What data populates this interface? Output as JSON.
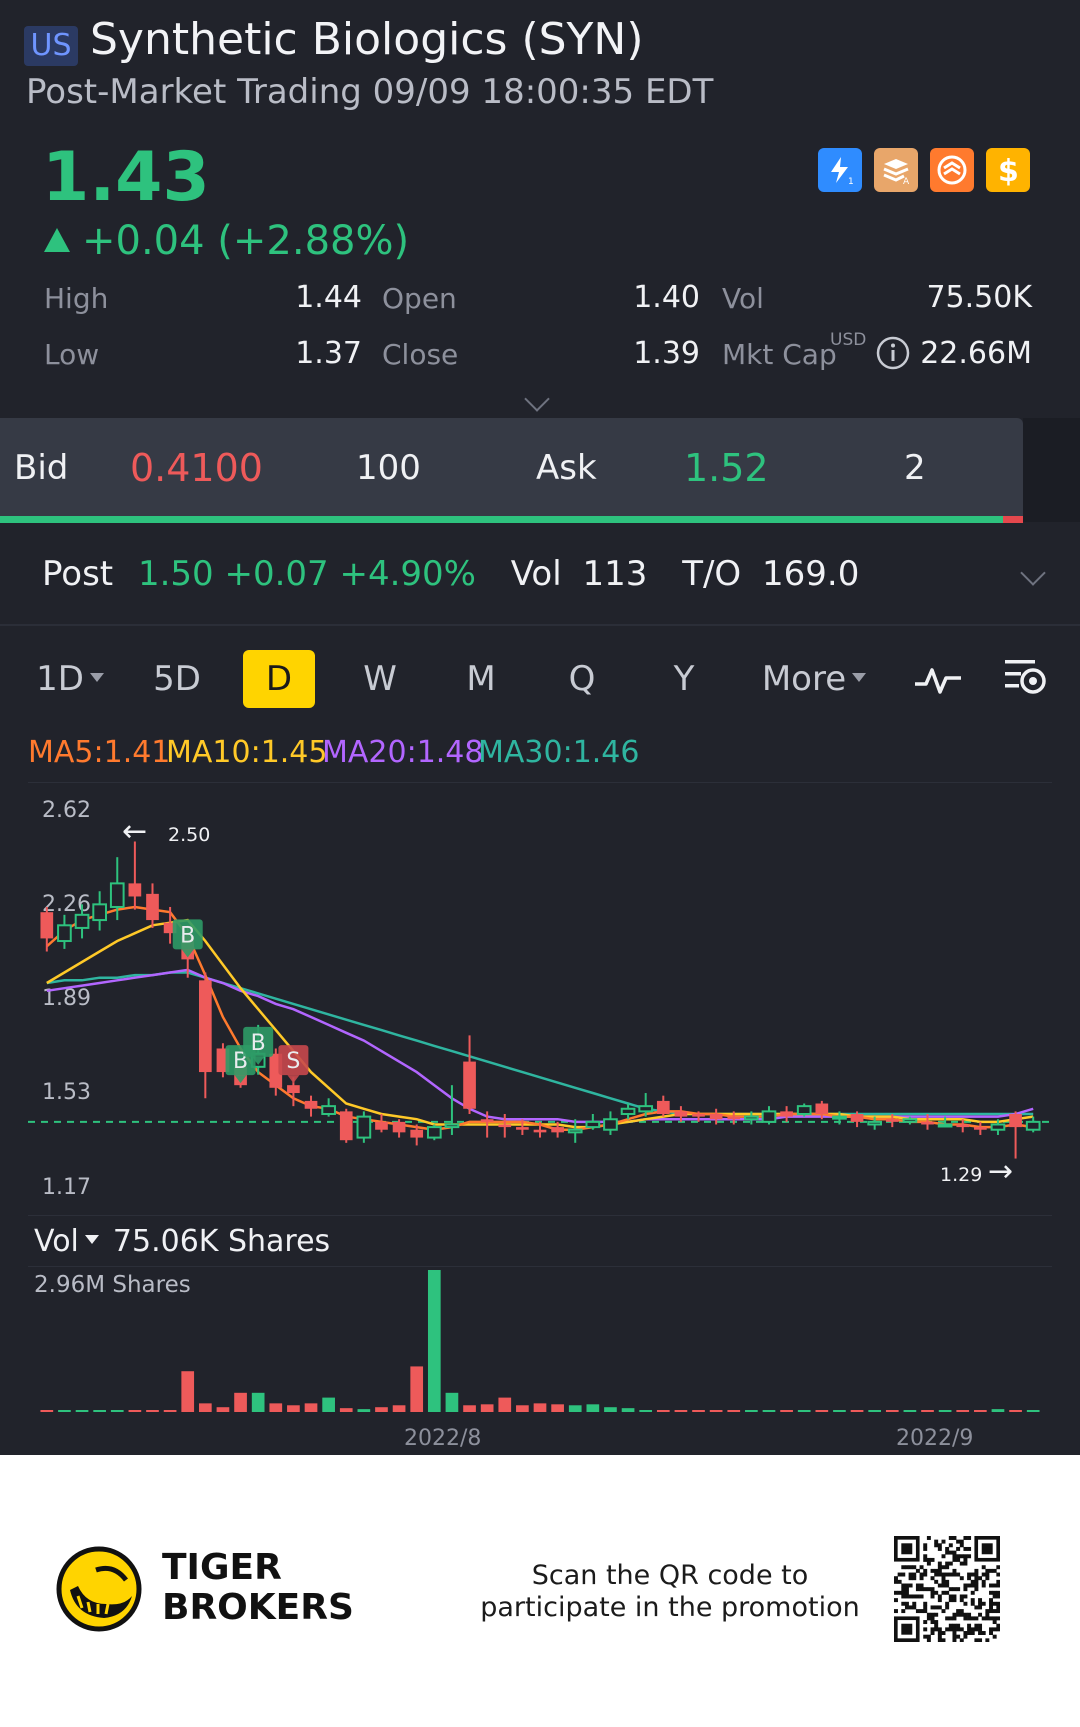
{
  "header": {
    "market_badge": "US",
    "title": "Synthetic Biologics (SYN)",
    "subtitle": "Post-Market Trading 09/09 18:00:35 EDT",
    "price": "1.43",
    "change": "+0.04 (+2.88%)",
    "quick_icons": [
      "lightning-level1-icon",
      "stack-a-icon",
      "swap-icon",
      "dollar-icon"
    ]
  },
  "stats": {
    "high_label": "High",
    "high": "1.44",
    "open_label": "Open",
    "open": "1.40",
    "vol_label": "Vol",
    "vol": "75.50K",
    "low_label": "Low",
    "low": "1.37",
    "close_label": "Close",
    "close": "1.39",
    "mktcap_label": "Mkt Cap",
    "mktcap_currency": "USD",
    "mktcap": "22.66M"
  },
  "bidask": {
    "bid_label": "Bid",
    "bid_price": "0.4100",
    "bid_size": "100",
    "ask_label": "Ask",
    "ask_price": "1.52",
    "ask_size": "2"
  },
  "post": {
    "label": "Post",
    "price_change": "1.50 +0.07 +4.90%",
    "vol_label": "Vol",
    "vol": "113",
    "to_label": "T/O",
    "to": "169.0"
  },
  "tabs": {
    "items": [
      "1D",
      "5D",
      "D",
      "W",
      "M",
      "Q",
      "Y",
      "More"
    ],
    "active": "D"
  },
  "ma": {
    "ma5": "MA5:1.41",
    "ma10": "MA10:1.45",
    "ma20": "MA20:1.48",
    "ma30": "MA30:1.46",
    "colors": {
      "ma5": "#ff7a2e",
      "ma10": "#ffc928",
      "ma20": "#b266ff",
      "ma30": "#2fb5a0"
    }
  },
  "chart_data": {
    "type": "candlestick",
    "y_ticks": [
      "2.62",
      "2.26",
      "1.89",
      "1.53",
      "1.17"
    ],
    "ylim": [
      1.17,
      2.62
    ],
    "high_annotation": "2.50",
    "low_annotation": "1.29",
    "reference_line": 1.43,
    "x_ticks": [
      "2022/8",
      "2022/9"
    ],
    "markers": [
      {
        "label": "B",
        "index": 8
      },
      {
        "label": "B",
        "index": 11
      },
      {
        "label": "B",
        "index": 12
      },
      {
        "label": "S",
        "index": 14
      }
    ],
    "candles": [
      [
        2.23,
        2.13,
        2.25,
        2.08
      ],
      [
        2.12,
        2.18,
        2.22,
        2.09
      ],
      [
        2.17,
        2.22,
        2.26,
        2.13
      ],
      [
        2.2,
        2.26,
        2.31,
        2.16
      ],
      [
        2.25,
        2.34,
        2.44,
        2.2
      ],
      [
        2.34,
        2.29,
        2.5,
        2.24
      ],
      [
        2.3,
        2.2,
        2.34,
        2.17
      ],
      [
        2.19,
        2.15,
        2.25,
        2.11
      ],
      [
        2.14,
        2.05,
        2.18,
        1.98
      ],
      [
        1.97,
        1.62,
        2.0,
        1.52
      ],
      [
        1.71,
        1.62,
        1.73,
        1.6
      ],
      [
        1.64,
        1.57,
        1.66,
        1.56
      ],
      [
        1.64,
        1.69,
        1.8,
        1.61
      ],
      [
        1.69,
        1.56,
        1.71,
        1.53
      ],
      [
        1.57,
        1.54,
        1.6,
        1.49
      ],
      [
        1.51,
        1.48,
        1.53,
        1.45
      ],
      [
        1.46,
        1.49,
        1.52,
        1.45
      ],
      [
        1.47,
        1.36,
        1.48,
        1.35
      ],
      [
        1.37,
        1.45,
        1.47,
        1.35
      ],
      [
        1.43,
        1.4,
        1.46,
        1.39
      ],
      [
        1.43,
        1.39,
        1.44,
        1.37
      ],
      [
        1.4,
        1.37,
        1.42,
        1.34
      ],
      [
        1.37,
        1.41,
        1.42,
        1.36
      ],
      [
        1.41,
        1.42,
        1.57,
        1.38
      ],
      [
        1.66,
        1.48,
        1.76,
        1.46
      ],
      [
        1.44,
        1.43,
        1.47,
        1.37
      ],
      [
        1.42,
        1.41,
        1.46,
        1.37
      ],
      [
        1.41,
        1.4,
        1.44,
        1.38
      ],
      [
        1.4,
        1.39,
        1.43,
        1.37
      ],
      [
        1.41,
        1.39,
        1.43,
        1.37
      ],
      [
        1.39,
        1.4,
        1.44,
        1.35
      ],
      [
        1.41,
        1.43,
        1.46,
        1.4
      ],
      [
        1.4,
        1.44,
        1.47,
        1.38
      ],
      [
        1.46,
        1.48,
        1.5,
        1.44
      ],
      [
        1.47,
        1.49,
        1.54,
        1.45
      ],
      [
        1.51,
        1.46,
        1.53,
        1.45
      ],
      [
        1.47,
        1.45,
        1.49,
        1.43
      ],
      [
        1.46,
        1.45,
        1.47,
        1.43
      ],
      [
        1.46,
        1.44,
        1.48,
        1.42
      ],
      [
        1.45,
        1.44,
        1.47,
        1.42
      ],
      [
        1.44,
        1.45,
        1.47,
        1.42
      ],
      [
        1.43,
        1.47,
        1.49,
        1.42
      ],
      [
        1.47,
        1.45,
        1.49,
        1.43
      ],
      [
        1.46,
        1.49,
        1.5,
        1.45
      ],
      [
        1.5,
        1.46,
        1.51,
        1.44
      ],
      [
        1.45,
        1.45,
        1.47,
        1.42
      ],
      [
        1.46,
        1.43,
        1.47,
        1.41
      ],
      [
        1.42,
        1.43,
        1.45,
        1.4
      ],
      [
        1.44,
        1.43,
        1.46,
        1.41
      ],
      [
        1.43,
        1.44,
        1.45,
        1.42
      ],
      [
        1.43,
        1.42,
        1.46,
        1.4
      ],
      [
        1.42,
        1.42,
        1.45,
        1.41
      ],
      [
        1.42,
        1.41,
        1.44,
        1.39
      ],
      [
        1.41,
        1.4,
        1.43,
        1.38
      ],
      [
        1.4,
        1.42,
        1.44,
        1.38
      ],
      [
        1.46,
        1.41,
        1.47,
        1.29
      ],
      [
        1.4,
        1.43,
        1.45,
        1.39
      ]
    ],
    "ma_lines": {
      "ma5": [
        2.1,
        2.16,
        2.2,
        2.22,
        2.24,
        2.25,
        2.24,
        2.23,
        2.14,
        1.99,
        1.83,
        1.71,
        1.62,
        1.57,
        1.52,
        1.49,
        1.48,
        1.45,
        1.44,
        1.43,
        1.42,
        1.41,
        1.4,
        1.41,
        1.43,
        1.43,
        1.43,
        1.43,
        1.42,
        1.4,
        1.4,
        1.41,
        1.42,
        1.44,
        1.46,
        1.47,
        1.47,
        1.46,
        1.46,
        1.45,
        1.45,
        1.45,
        1.46,
        1.46,
        1.46,
        1.45,
        1.45,
        1.44,
        1.44,
        1.43,
        1.43,
        1.42,
        1.42,
        1.41,
        1.41,
        1.42,
        1.41
      ],
      "ma10": [
        1.96,
        2.0,
        2.04,
        2.08,
        2.12,
        2.15,
        2.18,
        2.19,
        2.2,
        2.12,
        2.03,
        1.94,
        1.86,
        1.78,
        1.7,
        1.62,
        1.56,
        1.5,
        1.48,
        1.46,
        1.45,
        1.44,
        1.42,
        1.42,
        1.42,
        1.42,
        1.42,
        1.42,
        1.42,
        1.42,
        1.41,
        1.41,
        1.42,
        1.43,
        1.44,
        1.45,
        1.46,
        1.46,
        1.46,
        1.46,
        1.46,
        1.46,
        1.46,
        1.46,
        1.46,
        1.46,
        1.45,
        1.45,
        1.45,
        1.44,
        1.44,
        1.44,
        1.44,
        1.43,
        1.43,
        1.44,
        1.45
      ],
      "ma20": [
        1.93,
        1.94,
        1.95,
        1.96,
        1.97,
        1.98,
        1.99,
        2.0,
        2.01,
        1.98,
        1.96,
        1.93,
        1.91,
        1.88,
        1.86,
        1.83,
        1.8,
        1.77,
        1.74,
        1.7,
        1.66,
        1.62,
        1.57,
        1.52,
        1.48,
        1.45,
        1.44,
        1.44,
        1.44,
        1.44,
        1.43,
        1.43,
        1.43,
        1.43,
        1.44,
        1.44,
        1.44,
        1.44,
        1.44,
        1.44,
        1.44,
        1.44,
        1.45,
        1.45,
        1.45,
        1.45,
        1.45,
        1.45,
        1.45,
        1.45,
        1.45,
        1.45,
        1.45,
        1.45,
        1.45,
        1.46,
        1.48
      ],
      "ma30": [
        1.96,
        1.97,
        1.97,
        1.98,
        1.98,
        1.99,
        1.99,
        2.0,
        2.0,
        1.98,
        1.96,
        1.94,
        1.92,
        1.9,
        1.88,
        1.86,
        1.84,
        1.82,
        1.8,
        1.78,
        1.76,
        1.74,
        1.72,
        1.7,
        1.68,
        1.66,
        1.64,
        1.62,
        1.6,
        1.58,
        1.56,
        1.54,
        1.52,
        1.5,
        1.48,
        1.47,
        1.46,
        1.46,
        1.46,
        1.46,
        1.46,
        1.46,
        1.46,
        1.46,
        1.46,
        1.46,
        1.46,
        1.46,
        1.46,
        1.46,
        1.46,
        1.46,
        1.46,
        1.46,
        1.46,
        1.46,
        1.46
      ]
    },
    "volume_label": "Vol",
    "volume_value": "75.06K Shares",
    "volume_max_label": "2.96M Shares",
    "volume_max": 2.96,
    "volumes": [
      0.02,
      0.02,
      0.03,
      0.03,
      0.04,
      0.03,
      0.02,
      0.02,
      0.85,
      0.18,
      0.1,
      0.4,
      0.4,
      0.18,
      0.14,
      0.18,
      0.3,
      0.08,
      0.06,
      0.1,
      0.14,
      0.95,
      2.96,
      0.4,
      0.14,
      0.16,
      0.3,
      0.14,
      0.18,
      0.16,
      0.14,
      0.16,
      0.1,
      0.08,
      0.04,
      0.03,
      0.03,
      0.02,
      0.03,
      0.03,
      0.02,
      0.03,
      0.03,
      0.02,
      0.03,
      0.02,
      0.03,
      0.02,
      0.02,
      0.03,
      0.03,
      0.02,
      0.03,
      0.03,
      0.06,
      0.04,
      0.04
    ],
    "colors": {
      "up": "#2ec27e",
      "down": "#ee5a5a"
    }
  },
  "footer": {
    "brand_line1": "TIGER",
    "brand_line2": "BROKERS",
    "promo_text": "Scan the QR code to participate in the promotion"
  }
}
